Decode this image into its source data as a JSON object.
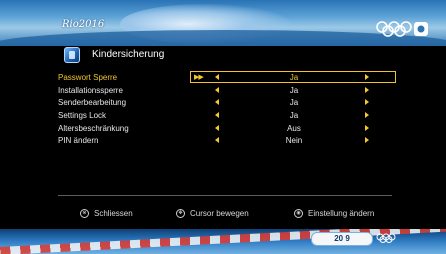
{
  "branding": {
    "rio_logo_text": "Rio2016",
    "badge_text": "20 9"
  },
  "page": {
    "title": "Kindersicherung"
  },
  "settings": [
    {
      "label": "Passwort Sperre",
      "value": "Ja",
      "selected": true
    },
    {
      "label": "Installationssperre",
      "value": "Ja"
    },
    {
      "label": "Senderbearbeitung",
      "value": "Ja"
    },
    {
      "label": "Settings Lock",
      "value": "Ja"
    },
    {
      "label": "Altersbeschränkung",
      "value": "Aus"
    },
    {
      "label": "PIN ändern",
      "value": "Nein"
    }
  ],
  "footer": {
    "hints": [
      {
        "icon": "exit-key-icon",
        "label": "Schliessen"
      },
      {
        "icon": "navigation-key-icon",
        "label": "Cursor bewegen"
      },
      {
        "icon": "ok-key-icon",
        "label": "Einstellung ändern"
      }
    ]
  },
  "colors": {
    "highlight": "#f0c52e",
    "text": "#e7e7e7",
    "background": "#000000"
  }
}
